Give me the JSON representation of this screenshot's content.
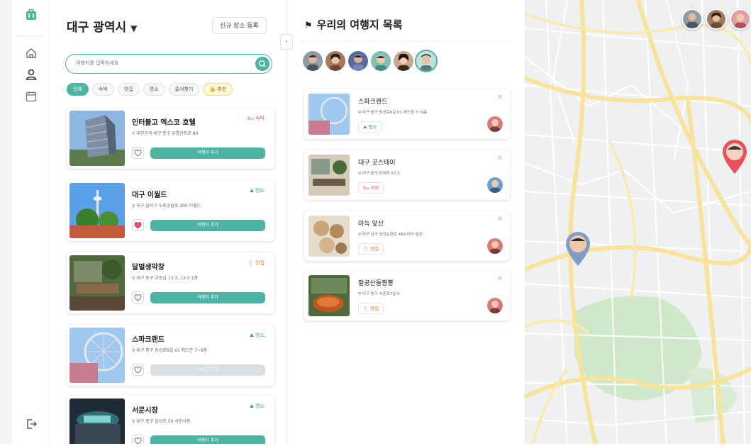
{
  "rail": {
    "logo": "suitcase-logo",
    "icons": [
      "home-icon",
      "user-icon",
      "calendar-icon",
      "logout-icon"
    ]
  },
  "places": {
    "region": "대구 광역시",
    "register_button": "신규 장소 등록",
    "search_placeholder": "여행지를 입력하세요",
    "chips": [
      "전체",
      "숙박",
      "맛집",
      "명소",
      "즐겨찾기",
      "추천"
    ],
    "add_label": "여행지 추가",
    "cards": [
      {
        "name": "인터불고 엑스코 호텔",
        "address": "대한민국 대구 동구 유통단지로 80",
        "category": "숙박",
        "kind": "stay",
        "favorite": false,
        "added": false
      },
      {
        "name": "대구 이월드",
        "address": "대구 달서구 두류공원로 200 이월드",
        "category": "명소",
        "kind": "place",
        "favorite": true,
        "added": false
      },
      {
        "name": "달벌생막창",
        "address": "대구 동구 교동길 13-3, 13-5 1층",
        "category": "맛집",
        "kind": "food",
        "favorite": false,
        "added": false
      },
      {
        "name": "스파크랜드",
        "address": "대구 중구 동성로6길 61 메드존 7~9층",
        "category": "명소",
        "kind": "place",
        "favorite": false,
        "added": true
      },
      {
        "name": "서문시장",
        "address": "대구 중구 달성로 50 서문시장",
        "category": "명소",
        "kind": "place",
        "favorite": false,
        "added": false
      }
    ]
  },
  "itinerary": {
    "title": "우리의 여행지 목록",
    "items": [
      {
        "name": "스파크랜드",
        "address": "대구 중구 동성로6길 61 메드존 7~9층",
        "tag": "명소",
        "kind": "place"
      },
      {
        "name": "대구 곳스테이",
        "address": "대구 중구 지하동 67-2",
        "tag": "숙박",
        "kind": "stay"
      },
      {
        "name": "아늑 앞산",
        "address": "대구 남구 앞산순환로 469 아늑 앞산",
        "tag": "맛집",
        "kind": "food"
      },
      {
        "name": "팔공산돌짬뽕",
        "address": "대구 동구 서촌로7길 5",
        "tag": "맛집",
        "kind": "food"
      }
    ]
  },
  "colors": {
    "accent": "#4db3a3",
    "stay": "#e0604f",
    "food": "#e07a2a",
    "pin_red": "#e8505b",
    "pin_blue": "#7e9ec8"
  }
}
